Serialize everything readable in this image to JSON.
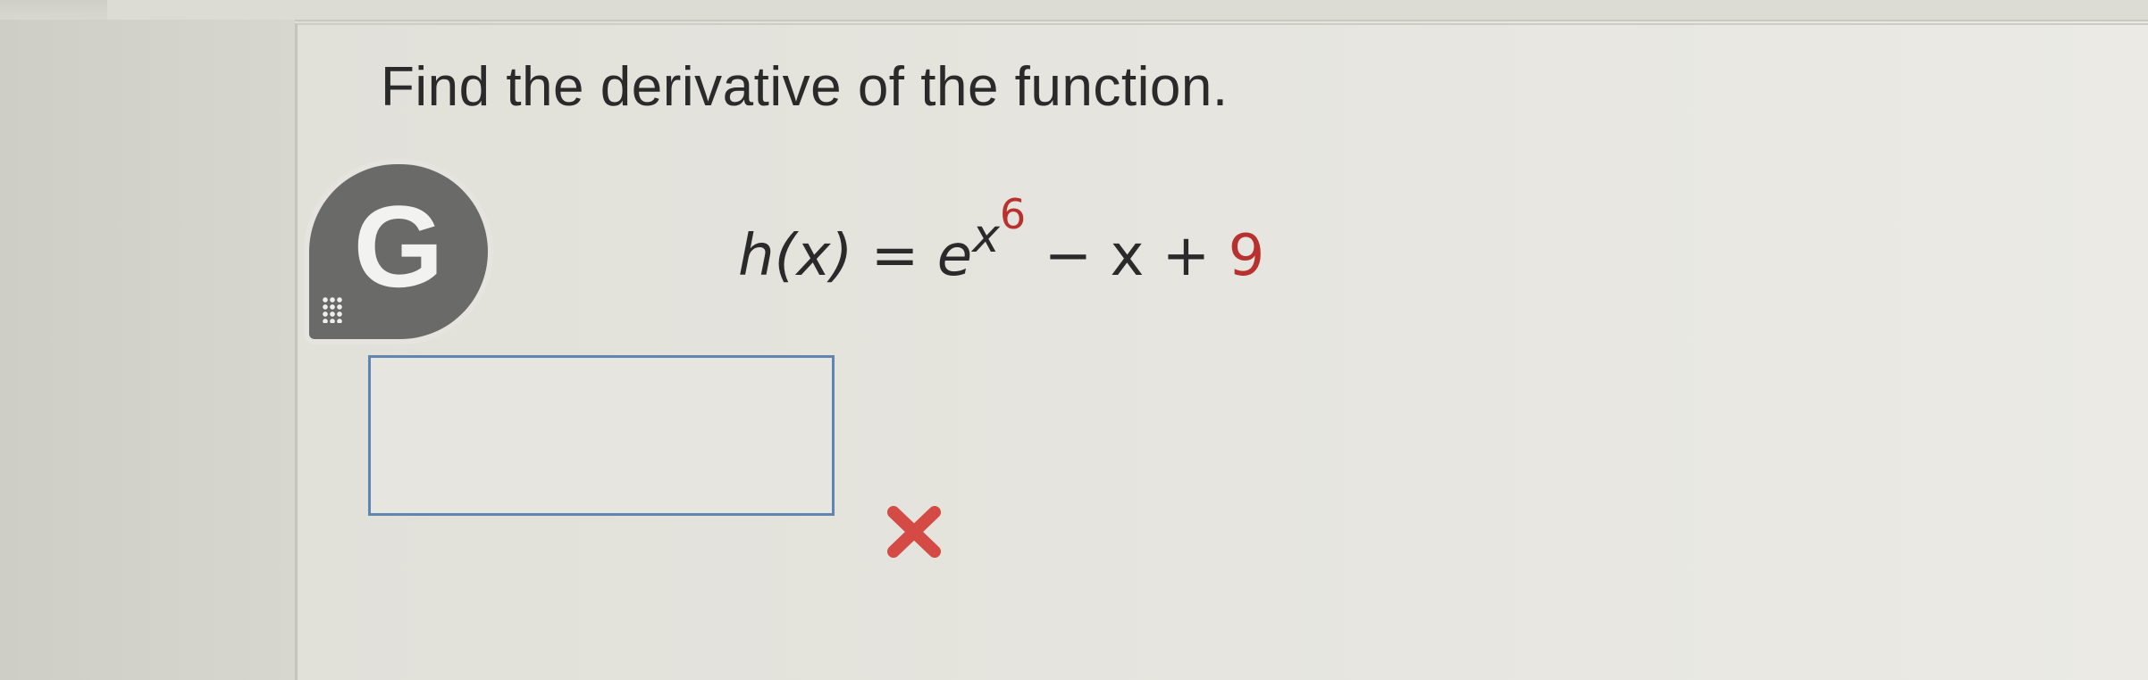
{
  "question": {
    "prompt": "Find the derivative of the function."
  },
  "badge": {
    "letter": "G",
    "icon": "g-logo-icon"
  },
  "equation": {
    "lhs": "h(x)",
    "equals": "=",
    "base": "e",
    "exponent_var": "x",
    "exponent_power": "6",
    "rest_minus": "− x +",
    "constant": "9"
  },
  "answer": {
    "value": "",
    "status_icon": "incorrect-x-icon"
  },
  "colors": {
    "answer_border": "#5f86b0",
    "highlight_red": "#b8312f",
    "wrong_mark": "#d44a44",
    "badge_gray": "#6a6a68"
  }
}
